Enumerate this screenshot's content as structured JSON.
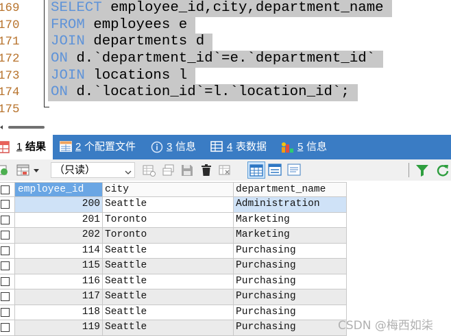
{
  "editor": {
    "lines": [
      {
        "number": "169",
        "keyword": "SELECT",
        "rest": " employee_id,city,department_name"
      },
      {
        "number": "170",
        "keyword": "FROM",
        "rest": " employees e"
      },
      {
        "number": "171",
        "keyword": "JOIN",
        "rest": " departments d"
      },
      {
        "number": "172",
        "keyword": "ON",
        "rest": " d.`department_id`=e.`department_id`"
      },
      {
        "number": "173",
        "keyword": "JOIN",
        "rest": " locations l"
      },
      {
        "number": "174",
        "keyword": "ON",
        "rest": " d.`location_id`=l.`location_id`;"
      },
      {
        "number": "175",
        "keyword": "",
        "rest": ""
      }
    ]
  },
  "result_tabs": [
    {
      "number": "1",
      "label": "结果",
      "icon": "result-grid-icon",
      "active": true
    },
    {
      "number": "2",
      "label": "个配置文件",
      "icon": "profile-table-icon",
      "active": false
    },
    {
      "number": "3",
      "label": "信息",
      "icon": "info-icon",
      "active": false
    },
    {
      "number": "4",
      "label": "表数据",
      "icon": "table-data-icon",
      "active": false
    },
    {
      "number": "5",
      "label": "信息",
      "icon": "history-info-icon",
      "active": false
    }
  ],
  "result_toolbar": {
    "mode_select": {
      "value": "（只读）"
    },
    "icons": [
      "refresh-result-icon",
      "grid-options-icon",
      "insert-row-icon",
      "duplicate-row-icon",
      "save-icon",
      "delete-row-icon",
      "reset-icon",
      "grid-view-icon",
      "form-view-icon",
      "text-view-icon",
      "filter-icon",
      "refresh-icon"
    ],
    "active_view": "grid-view-icon"
  },
  "result_grid": {
    "columns": [
      "employee_id",
      "city",
      "department_name"
    ],
    "rows": [
      [
        "200",
        "Seattle",
        "Administration"
      ],
      [
        "201",
        "Toronto",
        "Marketing"
      ],
      [
        "202",
        "Toronto",
        "Marketing"
      ],
      [
        "114",
        "Seattle",
        "Purchasing"
      ],
      [
        "115",
        "Seattle",
        "Purchasing"
      ],
      [
        "116",
        "Seattle",
        "Purchasing"
      ],
      [
        "117",
        "Seattle",
        "Purchasing"
      ],
      [
        "118",
        "Seattle",
        "Purchasing"
      ],
      [
        "119",
        "Seattle",
        "Purchasing"
      ]
    ]
  },
  "watermark": "CSDN @梅西如柒",
  "colors": {
    "keyword": "#5f93d8",
    "line_number": "#b8742e",
    "selection": "#c8c8c8",
    "tab_strip": "#3a7cc4",
    "header_selected": "#6aa6e4",
    "row_selected": "#cfe2f7",
    "row_alt": "#ebebeb"
  }
}
